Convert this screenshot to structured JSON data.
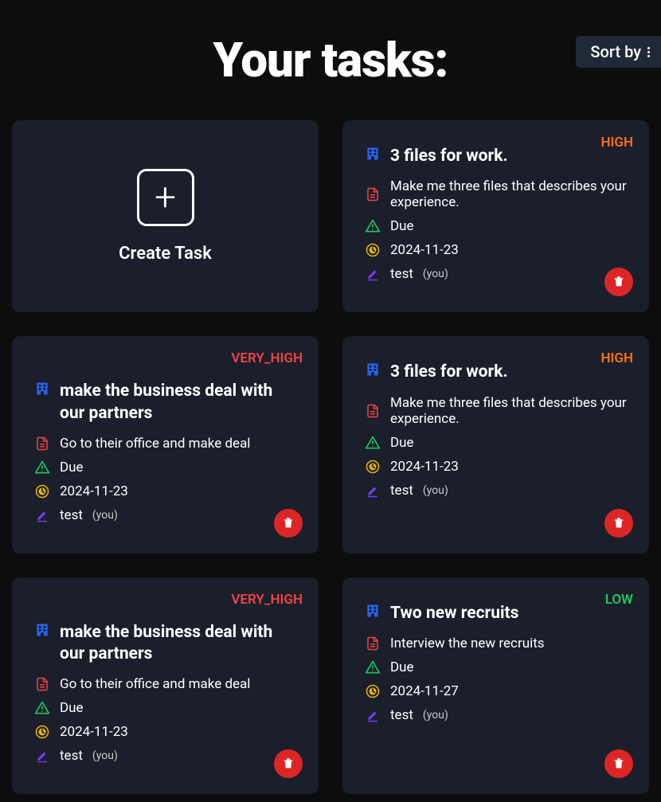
{
  "header": {
    "title": "Your tasks:",
    "sortLabel": "Sort by"
  },
  "createCard": {
    "label": "Create Task"
  },
  "youText": "(you)",
  "dueLabel": "Due",
  "tasks": [
    {
      "priority": "HIGH",
      "title": "3 files for work.",
      "description": "Make me three files that describes your experience.",
      "date": "2024-11-23",
      "user": "test"
    },
    {
      "priority": "VERY_HIGH",
      "title": "make the business deal with our partners",
      "description": "Go to their office and make deal",
      "date": "2024-11-23",
      "user": "test"
    },
    {
      "priority": "HIGH",
      "title": "3 files for work.",
      "description": "Make me three files that describes your experience.",
      "date": "2024-11-23",
      "user": "test"
    },
    {
      "priority": "VERY_HIGH",
      "title": "make the business deal with our partners",
      "description": "Go to their office and make deal",
      "date": "2024-11-23",
      "user": "test"
    },
    {
      "priority": "LOW",
      "title": "Two new recruits",
      "description": "Interview the new recruits",
      "date": "2024-11-27",
      "user": "test"
    }
  ]
}
